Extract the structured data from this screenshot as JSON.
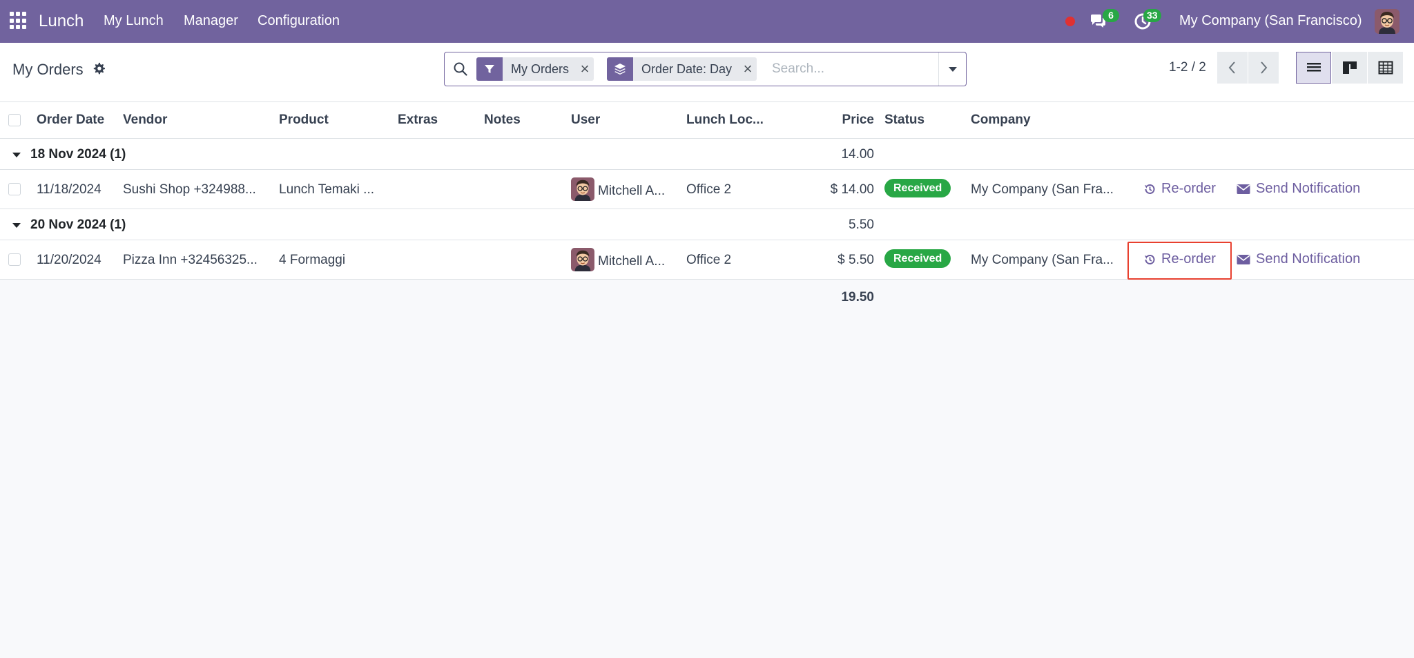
{
  "navbar": {
    "app_name": "Lunch",
    "menus": [
      "My Lunch",
      "Manager",
      "Configuration"
    ],
    "messages_count": "6",
    "activities_count": "33",
    "company": "My Company (San Francisco)",
    "color": "#71639e"
  },
  "control_panel": {
    "title": "My Orders",
    "facets": [
      {
        "label": "My Orders",
        "icon": "filter-icon"
      },
      {
        "label": "Order Date: Day",
        "icon": "group-by-icon"
      }
    ],
    "search_placeholder": "Search...",
    "pager": "1-2 / 2"
  },
  "table": {
    "columns": [
      "Order Date",
      "Vendor",
      "Product",
      "Extras",
      "Notes",
      "User",
      "Lunch Loc...",
      "Price",
      "Status",
      "Company"
    ],
    "groups": [
      {
        "label": "18 Nov 2024 (1)",
        "total": "14.00",
        "rows": [
          {
            "date": "11/18/2024",
            "vendor": "Sushi Shop +324988...",
            "product": "Lunch Temaki ...",
            "extras": "",
            "notes": "",
            "user": "Mitchell A...",
            "location": "Office 2",
            "price": "$ 14.00",
            "status": "Received",
            "company": "My Company (San Fra...",
            "reorder": "Re-order",
            "notify": "Send Notification"
          }
        ]
      },
      {
        "label": "20 Nov 2024 (1)",
        "total": "5.50",
        "rows": [
          {
            "date": "11/20/2024",
            "vendor": "Pizza Inn +32456325...",
            "product": "4 Formaggi",
            "extras": "",
            "notes": "",
            "user": "Mitchell A...",
            "location": "Office 2",
            "price": "$ 5.50",
            "status": "Received",
            "company": "My Company (San Fra...",
            "reorder": "Re-order",
            "notify": "Send Notification"
          }
        ]
      }
    ],
    "grand_total": "19.50",
    "status_color": "#28a745",
    "highlight_color": "#e8402f"
  }
}
